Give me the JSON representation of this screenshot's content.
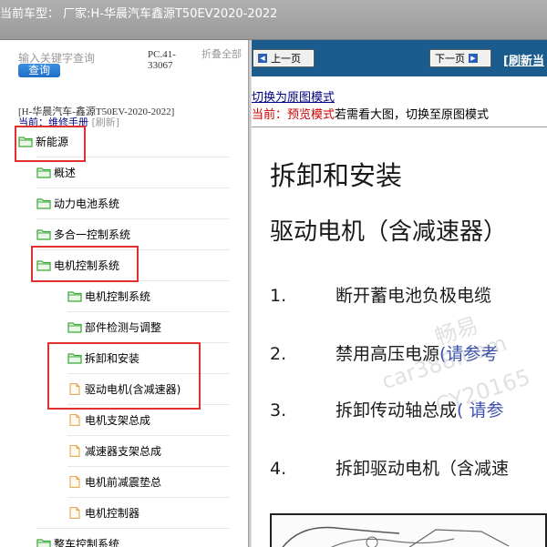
{
  "window": {
    "title": "当前车型： 厂家:H-华晨汽车鑫源T50EV2020-2022"
  },
  "left_panel": {
    "search": {
      "placeholder": "输入关键字查询",
      "button_label": "查询"
    },
    "pc_code": "PC.41-33067",
    "brand_tag": "折叠全部",
    "vehicle_line": "[H-华晨汽车-鑫源T50EV-2020-2022]",
    "current": {
      "label": "当前：维修手册",
      "refresh": "[刷新]"
    },
    "tree": [
      {
        "label": "新能源",
        "type": "folder"
      },
      {
        "label": "概述",
        "type": "folder"
      },
      {
        "label": "动力电池系统",
        "type": "folder"
      },
      {
        "label": "多合一控制系统",
        "type": "folder"
      },
      {
        "label": "电机控制系统",
        "type": "folder"
      },
      {
        "label": "电机控制系统",
        "type": "folder"
      },
      {
        "label": "部件检测与调整",
        "type": "folder"
      },
      {
        "label": "拆卸和安装",
        "type": "folder"
      },
      {
        "label": "驱动电机(含减速器)",
        "type": "page"
      },
      {
        "label": "电机支架总成",
        "type": "page"
      },
      {
        "label": "减速器支架总成",
        "type": "page"
      },
      {
        "label": "电机前减震垫总",
        "type": "page"
      },
      {
        "label": "电机控制器",
        "type": "page"
      },
      {
        "label": "整车控制系统",
        "type": "folder"
      }
    ]
  },
  "right_panel": {
    "nav": {
      "prev_label": "上一页",
      "next_label": "下一页",
      "refresh_label": "[刷新当"
    },
    "mode_link": "切换为原图模式",
    "mode_prefix": "当前：预览模式",
    "mode_rest": "若需看大图，切换至原图模式",
    "doc": {
      "heading": "拆卸和安装",
      "subheading": "驱动电机（含减速器）",
      "steps": [
        {
          "num": "1.",
          "text": "断开蓄电池负极电缆",
          "ref": ""
        },
        {
          "num": "2.",
          "text": "禁用高压电源",
          "ref": "(请参考"
        },
        {
          "num": "3.",
          "text": "拆卸传动轴总成",
          "ref": "( 请参"
        },
        {
          "num": "4.",
          "text": "拆卸驱动电机（含减速",
          "ref": ""
        }
      ]
    },
    "watermark": {
      "line1": "畅易",
      "line2": "car388.com",
      "line3": "CY20165"
    }
  },
  "colors": {
    "nav_bar": "#1b5c8f",
    "highlight_box": "#e03030",
    "folder_icon": "#3aa83a",
    "page_icon": "#e0a040",
    "mode_prefix": "#cc0000",
    "link": "#000080"
  }
}
